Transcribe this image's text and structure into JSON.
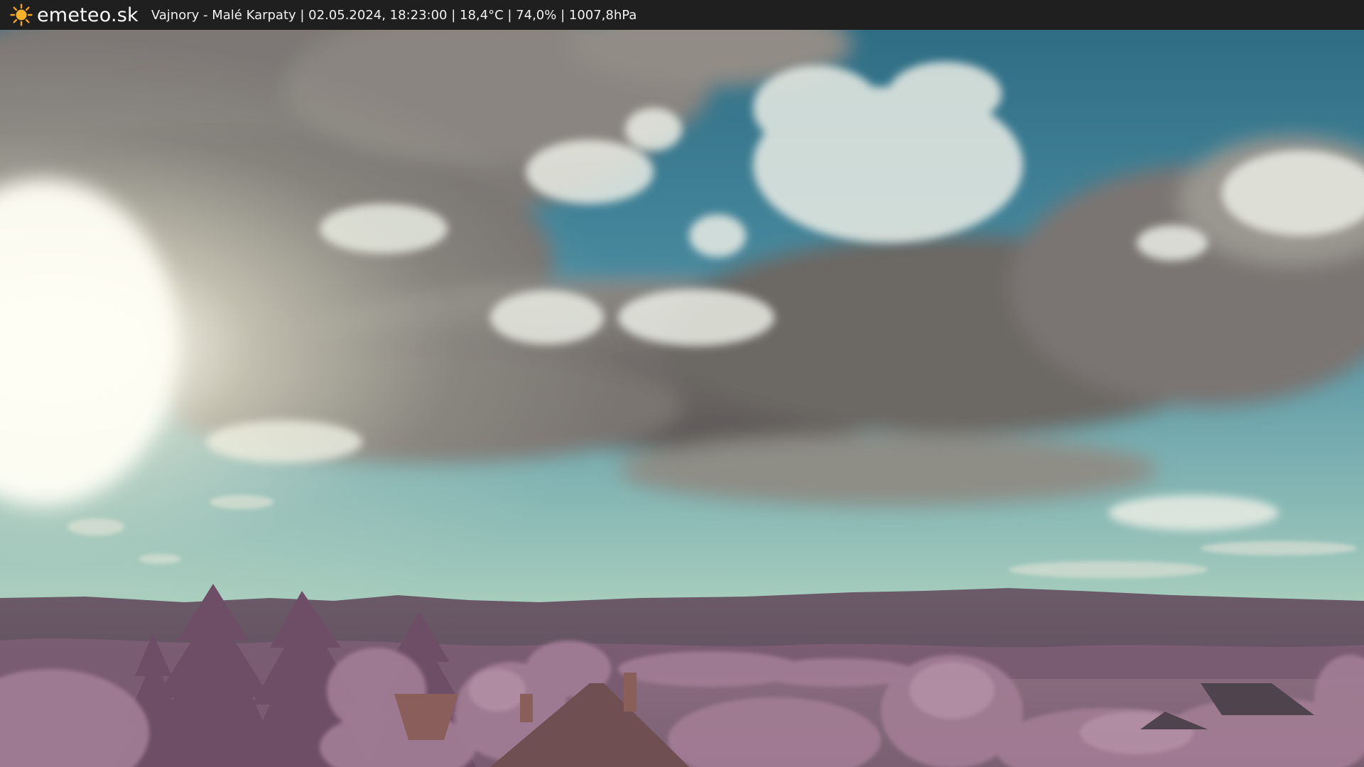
{
  "header": {
    "brand": "emeteo.sk",
    "info_text": "Vajnory - Malé Karpaty | 02.05.2024, 18:23:00 | 18,4°C | 74,0% | 1007,8hPa",
    "logo_icon": "sun-icon"
  },
  "colors": {
    "bar_background": "#1f1f1f",
    "sun_orange": "#f4a21c",
    "sky_blue": "#3f7f95",
    "foliage_pink": "#a9809c"
  }
}
